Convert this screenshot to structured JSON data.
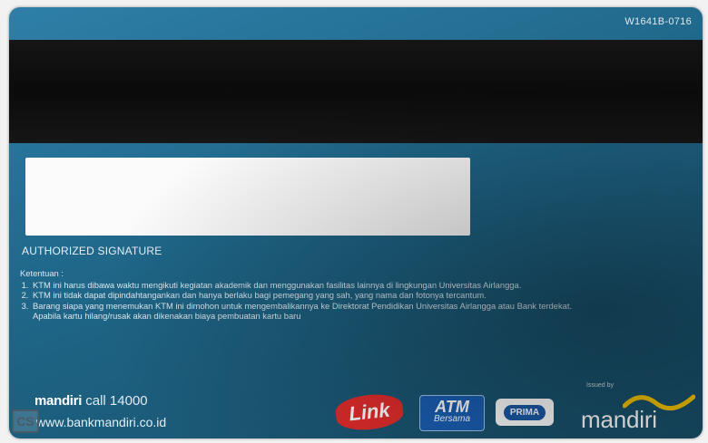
{
  "card": {
    "serial": "W1641B-0716",
    "signature_label": "AUTHORIZED SIGNATURE",
    "terms_heading": "Ketentuan :",
    "terms": [
      "KTM ini harus dibawa waktu mengikuti kegiatan akademik dan menggunakan fasilitas lainnya di lingkungan Universitas Airlangga.",
      "KTM ini tidak dapat dipindahtangankan dan hanya berlaku bagi pemegang yang sah, yang nama dan fotonya tercantum.",
      "Barang siapa yang menemukan KTM ini dimohon untuk mengembalikannya ke Direktorat Pendidikan Universitas Airlangga atau Bank terdekat. Apabila kartu hilang/rusak akan dikenakan biaya pembuatan kartu baru"
    ],
    "brand_name": "mandiri",
    "brand_call": "call 14000",
    "website": "www.bankmandiri.co.id",
    "logos": {
      "link": "Link",
      "atm_top": "ATM",
      "atm_bottom": "Bersama",
      "prima": "PRIMA"
    },
    "issued_by": "Issued by",
    "issuer_logo": "mandiri",
    "watermark": "CS"
  },
  "colors": {
    "card_blue": "#1f6688",
    "stripe": "#0b0b0b",
    "link_red": "#e32c2c",
    "atm_blue": "#1a5fb4",
    "mandiri_gold": "#f5c400"
  }
}
